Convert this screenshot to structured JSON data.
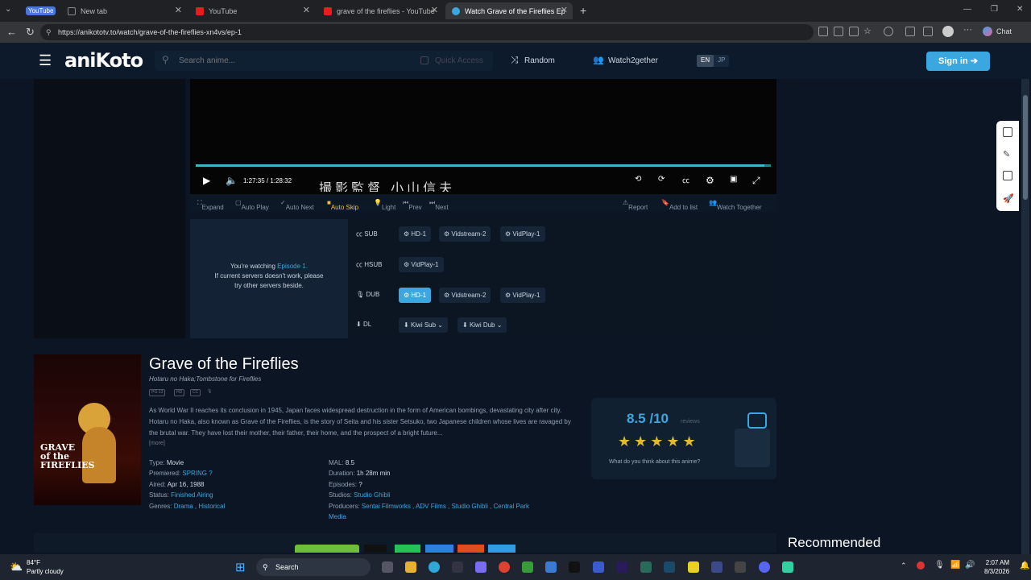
{
  "browser": {
    "tabs": [
      {
        "label": "New tab"
      },
      {
        "label": "YouTube"
      },
      {
        "label": "grave of the fireflies - YouTube"
      },
      {
        "label": "Watch Grave of the Fireflies Episo"
      }
    ],
    "pinned_tab": "YouTube",
    "url": "https://anikototv.to/watch/grave-of-the-fireflies-xn4vs/ep-1",
    "copilot_label": "Chat"
  },
  "header": {
    "logo": "aniKoto",
    "search_placeholder": "Search anime...",
    "quick_access": "Quick Access",
    "random": "Random",
    "watch2gether": "Watch2gether",
    "lang_en": "EN",
    "lang_jp": "JP",
    "signin": "Sign in"
  },
  "player": {
    "time": "1:27:35  /  1:28:32",
    "subtitle": "撮影監督   小山信夫",
    "progress": 0.989,
    "bar": {
      "expand": "Expand",
      "auto_play": "Auto Play",
      "auto_next": "Auto Next",
      "auto_skip": "Auto Skip",
      "light": "Light",
      "prev": "Prev",
      "next": "Next",
      "report": "Report",
      "add_to_list": "Add to list",
      "watch_together": "Watch Together"
    }
  },
  "servers": {
    "watching_prefix": "You're watching",
    "episode": "Episode 1.",
    "note": "If current servers doesn't work, please try other servers beside.",
    "rows": {
      "sub": {
        "label": "SUB",
        "servers": [
          "HD-1",
          "Vidstream-2",
          "VidPlay-1"
        ]
      },
      "hsub": {
        "label": "HSUB",
        "servers": [
          "VidPlay-1"
        ]
      },
      "dub": {
        "label": "DUB",
        "servers": [
          "HD-1",
          "Vidstream-2",
          "VidPlay-1"
        ]
      },
      "dl": {
        "label": "DL",
        "servers": [
          "Kiwi Sub",
          "Kiwi Dub"
        ]
      }
    }
  },
  "anime": {
    "title": "Grave of the Fireflies",
    "alt_title": "Hotaru no Haka;Tombstone for Fireflies",
    "tags": [
      "PG-13",
      "HD",
      "CC",
      "🎙"
    ],
    "poster_title": "GRAVE of the FIREFLIES",
    "synopsis": "As World War II reaches its conclusion in 1945, Japan faces widespread destruction in the form of American bombings, devastating city after city. Hotaru no Haka, also known as Grave of the Fireflies, is the story of Seita and his sister Setsuko, two Japanese children whose lives are ravaged by the brutal war. They have lost their mother, their father, their home, and the prospect of a bright future...",
    "more": "[more]",
    "meta": {
      "type_label": "Type:",
      "type": "Movie",
      "premiered_label": "Premiered:",
      "premiered": "SPRING ?",
      "aired_label": "Aired:",
      "aired": "Apr 16, 1988",
      "status_label": "Status:",
      "status": "Finished Airing",
      "genres_label": "Genres:",
      "genres": "Drama , Historical",
      "mal_label": "MAL:",
      "mal": "8.5",
      "duration_label": "Duration:",
      "duration": "1h 28m min",
      "episodes_label": "Episodes:",
      "episodes": "?",
      "studios_label": "Studios:",
      "studios": "Studio Ghibli",
      "producers_label": "Producers:",
      "producers": "Sentai Filmworks , ADV Films , Studio Ghibli , Central Park",
      "producers_2": "Media"
    }
  },
  "rating": {
    "score": "8.5 /10",
    "reviews": "reviews",
    "stars": "★★★★★",
    "stars_value": 4.5,
    "question": "What do you think about this anime?"
  },
  "recommended": "Recommended",
  "taskbar": {
    "temp": "84°F",
    "weather": "Partly cloudy",
    "search": "Search",
    "time": "2:07 AM",
    "date": "8/3/2026"
  },
  "colors": {
    "accent": "#3aa7e0",
    "auto_skip": "#f2c230",
    "page_bg": "#0b1523"
  }
}
